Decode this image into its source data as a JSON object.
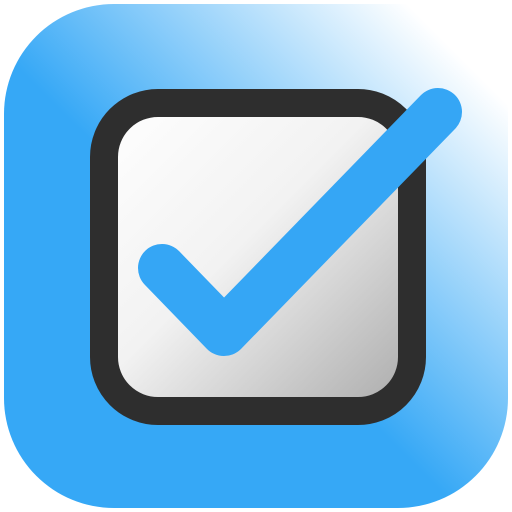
{
  "app_icon": {
    "icon": "checkbox-checked-icon",
    "colors": {
      "background_primary": "#36A8F6",
      "background_highlight": "#FFFFFF",
      "checkbox_border": "#2E2E2E",
      "checkbox_fill_light": "#FFFFFF",
      "checkbox_fill_dark": "#A9A9A9",
      "checkmark": "#35A6F5"
    }
  }
}
